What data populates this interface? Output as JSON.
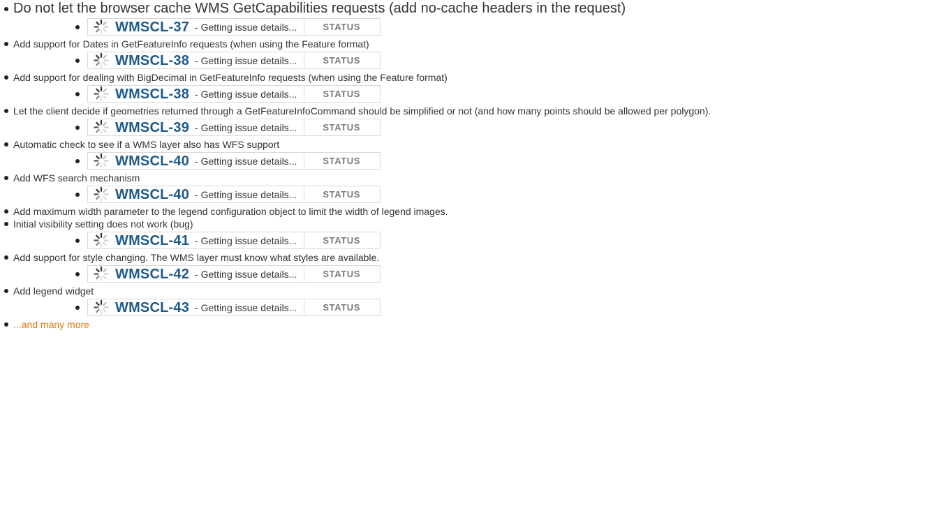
{
  "items": [
    {
      "text": "Do not let the browser cache WMS GetCapabilities requests (add no-cache headers in the request)",
      "issue": {
        "key": "WMSCL-37",
        "separator": "-",
        "summary": "Getting issue details...",
        "status": "STATUS"
      }
    },
    {
      "text": "Add support for Dates in GetFeatureInfo requests (when using the Feature format)",
      "issue": {
        "key": "WMSCL-38",
        "separator": "-",
        "summary": "Getting issue details...",
        "status": "STATUS"
      }
    },
    {
      "text": "Add support for dealing with BigDecimal in GetFeatureInfo requests (when using the Feature format)",
      "issue": {
        "key": "WMSCL-38",
        "separator": "-",
        "summary": "Getting issue details...",
        "status": "STATUS"
      }
    },
    {
      "text": "Let the client decide if geometries returned through a GetFeatureInfoCommand should be simplified or not (and how many points should be allowed per polygon).",
      "issue": {
        "key": "WMSCL-39",
        "separator": "-",
        "summary": "Getting issue details...",
        "status": "STATUS"
      }
    },
    {
      "text": "Automatic check to see if a WMS layer also has WFS support",
      "issue": {
        "key": "WMSCL-40",
        "separator": "-",
        "summary": "Getting issue details...",
        "status": "STATUS"
      }
    },
    {
      "text": "Add WFS search mechanism",
      "issue": {
        "key": "WMSCL-40",
        "separator": "-",
        "summary": "Getting issue details...",
        "status": "STATUS"
      }
    },
    {
      "text": "Add maximum width parameter to the legend configuration object to limit the width of legend images."
    },
    {
      "text": "Initial visibility setting does not work (bug)",
      "issue": {
        "key": "WMSCL-41",
        "separator": "-",
        "summary": "Getting issue details...",
        "status": "STATUS"
      }
    },
    {
      "text": "Add support for style changing. The WMS layer must know what styles are available.",
      "issue": {
        "key": "WMSCL-42",
        "separator": "-",
        "summary": "Getting issue details...",
        "status": "STATUS"
      }
    },
    {
      "text": "Add legend widget",
      "issue": {
        "key": "WMSCL-43",
        "separator": "-",
        "summary": "Getting issue details...",
        "status": "STATUS"
      }
    }
  ],
  "more_link": "...and many more",
  "colors": {
    "issue_key": "#1e5a8a",
    "status_text": "#7a7a7a",
    "more_link": "#e07a10",
    "box_border": "#d9d9d9"
  },
  "icons": {
    "issue_loading": "spinner-icon",
    "bullet": "bullet-dot"
  }
}
